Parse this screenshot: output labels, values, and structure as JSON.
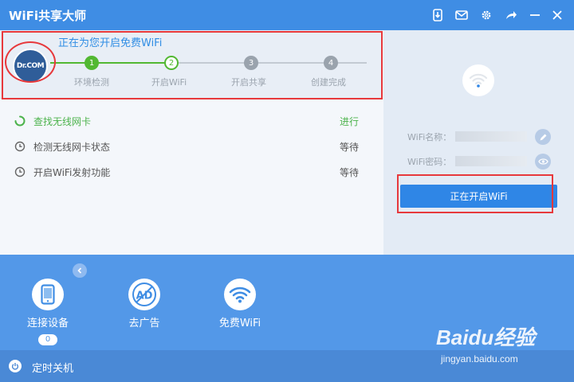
{
  "window": {
    "title": "WiFi共享大师"
  },
  "titlebar": {
    "icons": [
      "download-icon",
      "mail-icon",
      "gear-icon",
      "share-icon",
      "minimize-icon",
      "close-icon"
    ]
  },
  "progress": {
    "title": "正在为您开启免费WiFi",
    "logo_text": "Dr.COM",
    "current_step": 2,
    "steps": [
      {
        "number": "1",
        "label": "环境检测",
        "state": "done"
      },
      {
        "number": "2",
        "label": "开启WiFi",
        "state": "active"
      },
      {
        "number": "3",
        "label": "开启共享",
        "state": "pending"
      },
      {
        "number": "4",
        "label": "创建完成",
        "state": "pending"
      }
    ]
  },
  "tasks": [
    {
      "label": "查找无线网卡",
      "status": "进行",
      "state": "running"
    },
    {
      "label": "检测无线网卡状态",
      "status": "等待",
      "state": "waiting"
    },
    {
      "label": "开启WiFi发射功能",
      "status": "等待",
      "state": "waiting"
    }
  ],
  "wifi_panel": {
    "name_label": "WiFi名称：",
    "name_value": "",
    "password_label": "WiFi密码：",
    "password_value": "",
    "start_button": "正在开启WiFi"
  },
  "tools": [
    {
      "label": "连接设备",
      "icon": "phone-icon",
      "badge": "0"
    },
    {
      "label": "去广告",
      "icon": "ad-block-icon"
    },
    {
      "label": "免费WiFi",
      "icon": "wifi-icon"
    }
  ],
  "footer": {
    "label": "定时关机"
  },
  "watermark": {
    "logo": "Baidu经验",
    "url": "jingyan.baidu.com"
  },
  "colors": {
    "accent": "#3f8de4",
    "done_green": "#52b832",
    "pending_gray": "#9aa3ad",
    "highlight_red": "#e7393c",
    "bottom_panel": "#5398e8"
  }
}
